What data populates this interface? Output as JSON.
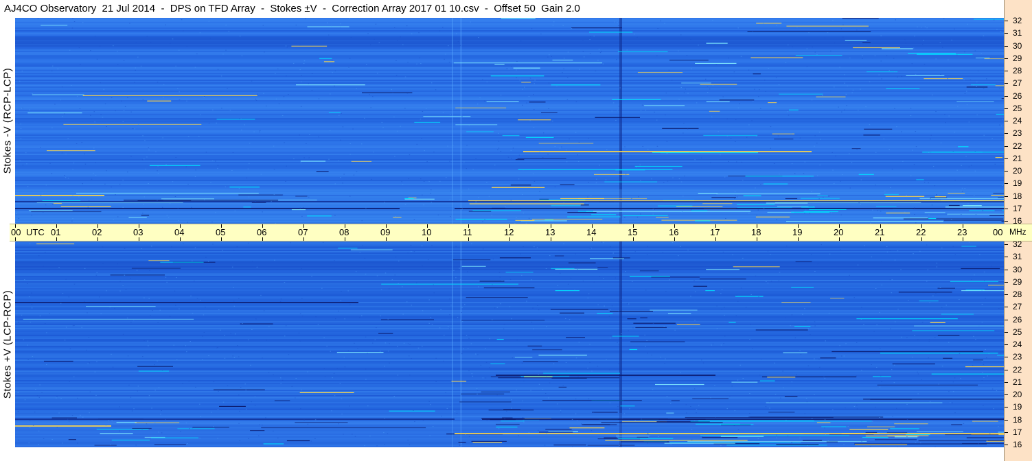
{
  "title": "AJ4CO Observatory  21 Jul 2014  -  DPS on TFD Array  -  Stokes ±V  -  Correction Array 2017 01 10.csv  -  Offset 50  Gain 2.0",
  "chart_data": [
    {
      "type": "heatmap",
      "ylabel": "Stokes -V (RCP-LCP)",
      "x_unit": "UTC",
      "y_unit": "MHz",
      "x_ticks": [
        "00",
        "01",
        "02",
        "03",
        "04",
        "05",
        "06",
        "07",
        "08",
        "09",
        "10",
        "11",
        "12",
        "13",
        "14",
        "15",
        "16",
        "17",
        "18",
        "19",
        "20",
        "21",
        "22",
        "23",
        "00"
      ],
      "y_ticks": [
        16,
        17,
        18,
        19,
        20,
        21,
        22,
        23,
        24,
        25,
        26,
        27,
        28,
        29,
        30,
        31,
        32
      ],
      "ylim": [
        16,
        32
      ],
      "xlim_hours": [
        0,
        24
      ],
      "colors": {
        "background": "#2a6fe6",
        "noise": "#3d8bf0",
        "strong": "#ffd84a",
        "weak": "#00e0ff",
        "negative": "#0a1a6e"
      }
    },
    {
      "type": "heatmap",
      "ylabel": "Stokes +V (LCP-RCP)",
      "x_unit": "UTC",
      "y_unit": "MHz",
      "x_ticks": [
        "00",
        "01",
        "02",
        "03",
        "04",
        "05",
        "06",
        "07",
        "08",
        "09",
        "10",
        "11",
        "12",
        "13",
        "14",
        "15",
        "16",
        "17",
        "18",
        "19",
        "20",
        "21",
        "22",
        "23",
        "00"
      ],
      "y_ticks": [
        16,
        17,
        18,
        19,
        20,
        21,
        22,
        23,
        24,
        25,
        26,
        27,
        28,
        29,
        30,
        31,
        32
      ],
      "ylim": [
        16,
        32
      ],
      "xlim_hours": [
        0,
        24
      ],
      "colors": {
        "background": "#1f5fd9",
        "noise": "#3a82ee",
        "strong": "#ffd84a",
        "weak": "#00e0ff",
        "negative": "#0a1a6e"
      }
    }
  ],
  "axis": {
    "utc_label": "UTC",
    "mhz_label": "MHz"
  }
}
